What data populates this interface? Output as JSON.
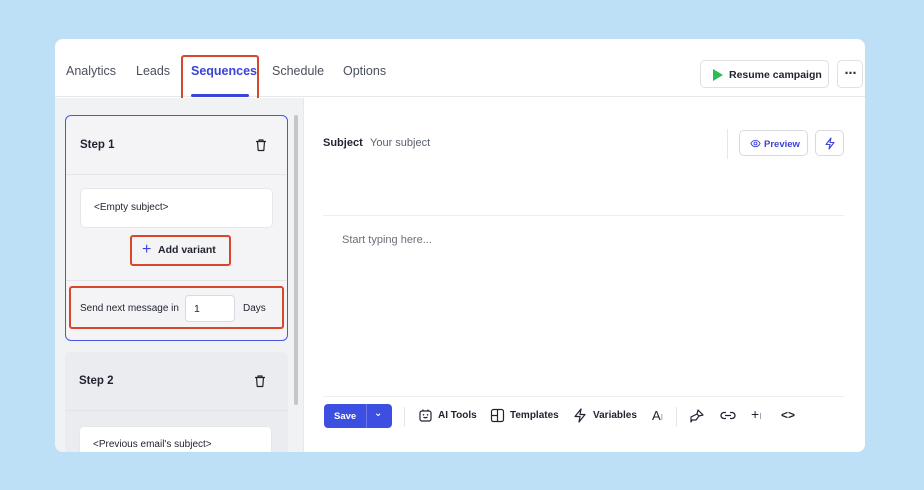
{
  "tabs": {
    "items": [
      "Analytics",
      "Leads",
      "Sequences",
      "Schedule",
      "Options"
    ],
    "active": "Sequences"
  },
  "header": {
    "resume_label": "Resume campaign",
    "more_label": "⋯",
    "resume_icon_color": "#2dbb56"
  },
  "steps": [
    {
      "title": "Step 1",
      "subject": "<Empty subject>",
      "add_variant_label": "Add variant",
      "send_next_label": "Send next message in",
      "send_next_value": "1",
      "send_next_unit": "Days"
    },
    {
      "title": "Step 2",
      "subject": "<Previous email's subject>"
    }
  ],
  "editor": {
    "subject_label": "Subject",
    "subject_placeholder": "Your subject",
    "preview_label": "Preview",
    "body_placeholder": "Start typing here..."
  },
  "toolbar": {
    "save_label": "Save",
    "ai_tools_label": "AI Tools",
    "templates_label": "Templates",
    "variables_label": "Variables"
  },
  "colors": {
    "accent": "#3a44d6",
    "save_button": "#3d4fe0",
    "highlight": "#d9472b",
    "background": "#bee0f6"
  },
  "icons": [
    "trash-icon",
    "plus-icon",
    "play-icon",
    "more-icon",
    "eye-icon",
    "bolt-icon",
    "chevron-down-icon",
    "ai-tools-icon",
    "templates-icon",
    "variables-icon",
    "font-size-icon",
    "brush-icon",
    "link-icon",
    "insert-icon",
    "code-icon"
  ]
}
